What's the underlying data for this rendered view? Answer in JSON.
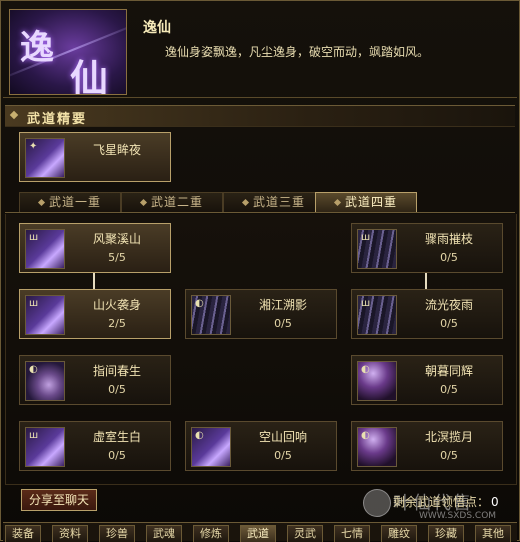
{
  "header": {
    "emblem_char1": "逸",
    "emblem_char2": "仙",
    "title": "逸仙",
    "description": "逸仙身姿飘逸，凡尘逸身，破空而动，飒踏如风。"
  },
  "section": {
    "title": "武道精要"
  },
  "special_skill": {
    "name": "飞星眸夜"
  },
  "tabs": [
    {
      "label": "武道一重",
      "active": false
    },
    {
      "label": "武道二重",
      "active": false
    },
    {
      "label": "武道三重",
      "active": false
    },
    {
      "label": "武道四重",
      "active": true
    }
  ],
  "skills": [
    {
      "name": "风聚溪山",
      "level": "5/5",
      "icon": "wind-skill-icon",
      "active": true
    },
    {
      "name": "骤雨摧枝",
      "level": "0/5",
      "icon": "rain-skill-icon",
      "active": false
    },
    {
      "name": "山火袭身",
      "level": "2/5",
      "icon": "fire-skill-icon",
      "active": true
    },
    {
      "name": "湘江溯影",
      "level": "0/5",
      "icon": "shadow-skill-icon",
      "active": false
    },
    {
      "name": "流光夜雨",
      "level": "0/5",
      "icon": "streak-skill-icon",
      "active": false
    },
    {
      "name": "指间春生",
      "level": "0/5",
      "icon": "swirl-skill-icon",
      "active": false
    },
    {
      "name": "朝暮同辉",
      "level": "0/5",
      "icon": "moon-skill-icon",
      "active": false
    },
    {
      "name": "虚室生白",
      "level": "0/5",
      "icon": "blade-skill-icon",
      "active": false
    },
    {
      "name": "空山回响",
      "level": "0/5",
      "icon": "echo-skill-icon",
      "active": false
    },
    {
      "name": "北溟揽月",
      "level": "0/5",
      "icon": "vortex-skill-icon",
      "active": false
    }
  ],
  "footer": {
    "share_label": "分享至聊天",
    "remaining_label": "剩余武道领悟点：",
    "remaining_value": "0"
  },
  "bottom_tabs": [
    {
      "label": "装备"
    },
    {
      "label": "资料"
    },
    {
      "label": "珍兽"
    },
    {
      "label": "武魂"
    },
    {
      "label": "修炼"
    },
    {
      "label": "武道",
      "active": true
    },
    {
      "label": "灵武"
    },
    {
      "label": "七情"
    },
    {
      "label": "雕纹"
    },
    {
      "label": "珍藏"
    },
    {
      "label": "其他"
    }
  ],
  "watermark": {
    "text": "叶仙代售",
    "url": "WWW.SXDS.COM"
  },
  "colors": {
    "accent": "#b8a06a",
    "background": "#0d0a06",
    "text": "#e9d9a8"
  }
}
